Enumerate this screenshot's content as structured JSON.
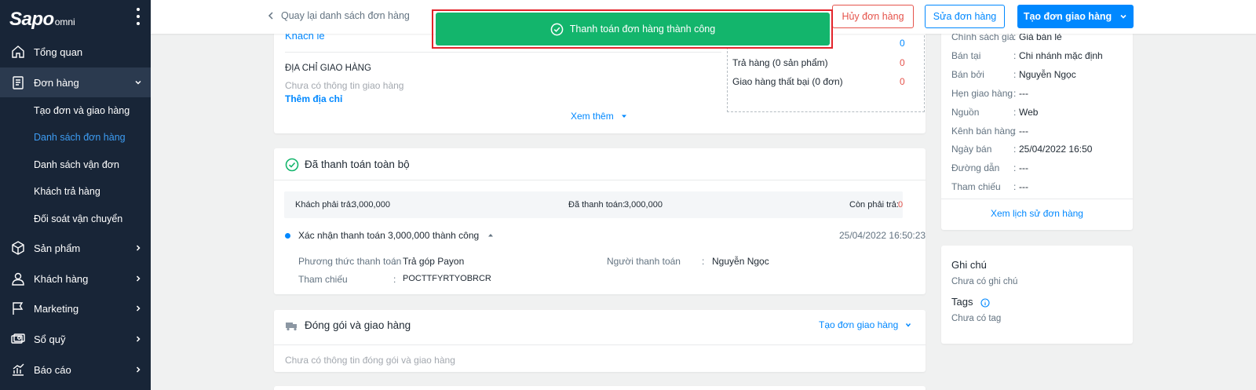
{
  "app": {
    "logo_main": "Sapo",
    "logo_sub": "omni"
  },
  "sidebar": {
    "items": [
      {
        "label": "Tổng quan",
        "icon": "home-icon"
      },
      {
        "label": "Đơn hàng",
        "icon": "order-icon",
        "expanded": true
      },
      {
        "label": "Sản phẩm",
        "icon": "box-icon"
      },
      {
        "label": "Khách hàng",
        "icon": "user-icon"
      },
      {
        "label": "Marketing",
        "icon": "flag-icon"
      },
      {
        "label": "Sổ quỹ",
        "icon": "cash-icon"
      },
      {
        "label": "Báo cáo",
        "icon": "chart-icon"
      }
    ],
    "order_sub": [
      {
        "label": "Tạo đơn và giao hàng"
      },
      {
        "label": "Danh sách đơn hàng",
        "active": true
      },
      {
        "label": "Danh sách vận đơn"
      },
      {
        "label": "Khách trả hàng"
      },
      {
        "label": "Đối soát vận chuyển"
      }
    ]
  },
  "topbar": {
    "back_label": "Quay lại danh sách đơn hàng",
    "cancel_label": "Hủy đơn hàng",
    "edit_label": "Sửa đơn hàng",
    "create_label": "Tạo đơn giao hàng"
  },
  "toast": {
    "message": "Thanh toán đơn hàng thành công"
  },
  "customer": {
    "name": "Khách lẻ",
    "address_heading": "ĐỊA CHỈ GIAO HÀNG",
    "address_empty": "Chưa có thông tin giao hàng",
    "add_address": "Thêm địa chỉ",
    "see_more": "Xem thêm",
    "stats": [
      {
        "label": "Trả hàng (0 sản phẩm)",
        "value": "0"
      },
      {
        "label": "Giao hàng thất bại (0 đơn)",
        "value": "0"
      },
      {
        "value": "0"
      }
    ]
  },
  "payment": {
    "title": "Đã thanh toán toàn bộ",
    "must_pay_label": "Khách phải trả:",
    "must_pay_value": "3,000,000",
    "paid_label": "Đã thanh toán:",
    "paid_value": "3,000,000",
    "remaining_label": "Còn phải trả:",
    "remaining_value": "0",
    "confirm_text": "Xác nhận thanh toán 3,000,000 thành công",
    "confirm_time": "25/04/2022 16:50:23",
    "method_label": "Phương thức thanh toán",
    "method_value": "Trả góp Payon",
    "payer_label": "Người thanh toán",
    "payer_value": "Nguyễn Ngọc",
    "ref_label": "Tham chiếu",
    "ref_value": "POCTTFYRTYOBRCR"
  },
  "shipping": {
    "title": "Đóng gói và giao hàng",
    "create_label": "Tạo đơn giao hàng",
    "empty": "Chưa có thông tin đóng gói và giao hàng"
  },
  "info": {
    "rows": [
      {
        "label": "Chính sách giá",
        "value": "Giá bán lẻ"
      },
      {
        "label": "Bán tại",
        "value": "Chi nhánh mặc định"
      },
      {
        "label": "Bán bởi",
        "value": "Nguyễn Ngọc"
      },
      {
        "label": "Hẹn giao hàng",
        "value": "---"
      },
      {
        "label": "Nguồn",
        "value": "Web"
      },
      {
        "label": "Kênh bán hàng",
        "value": "---"
      },
      {
        "label": "Ngày bán",
        "value": "25/04/2022 16:50"
      },
      {
        "label": "Đường dẫn",
        "value": "---"
      },
      {
        "label": "Tham chiếu",
        "value": "---"
      }
    ],
    "history_link": "Xem lịch sử đơn hàng"
  },
  "notes": {
    "title": "Ghi chú",
    "empty": "Chưa có ghi chú",
    "tags_title": "Tags",
    "tags_empty": "Chưa có tag"
  },
  "colors": {
    "sidebar_bg": "#182537",
    "accent": "#0088ff",
    "success": "#13b56c",
    "danger": "#e5534b"
  }
}
